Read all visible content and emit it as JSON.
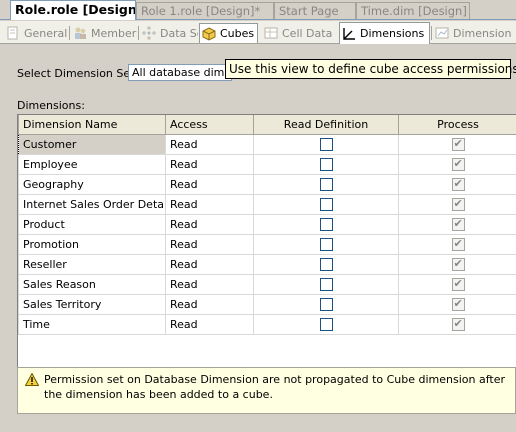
{
  "doc_tabs": [
    {
      "label": "Role.role [Design]",
      "active": true
    },
    {
      "label": "Role 1.role [Design]*",
      "active": false
    },
    {
      "label": "Start Page",
      "active": false
    },
    {
      "label": "Time.dim [Design]",
      "active": false
    }
  ],
  "view_tabs": [
    {
      "label": "General",
      "icon": "general-icon"
    },
    {
      "label": "Members",
      "icon": "members-icon"
    },
    {
      "label": "Data Sources",
      "icon": "data-sources-icon"
    },
    {
      "label": "Cubes",
      "icon": "cube-icon"
    },
    {
      "label": "Cell Data",
      "icon": "cell-data-icon"
    },
    {
      "label": "Dimensions",
      "icon": "dimensions-icon"
    },
    {
      "label": "Dimension Data",
      "icon": "dimension-data-icon"
    }
  ],
  "select_dimension_set": {
    "label": "Select Dimension Set:",
    "value": "All database dimensions"
  },
  "tooltip": "Use this view to define cube access permissions.",
  "dimensions_label": "Dimensions:",
  "grid": {
    "columns": [
      "Dimension Name",
      "Access",
      "Read Definition",
      "Process"
    ],
    "rows": [
      {
        "name": "Customer",
        "access": "Read",
        "read_definition": false,
        "process": true
      },
      {
        "name": "Employee",
        "access": "Read",
        "read_definition": false,
        "process": true
      },
      {
        "name": "Geography",
        "access": "Read",
        "read_definition": false,
        "process": true
      },
      {
        "name": "Internet Sales Order Details",
        "access": "Read",
        "read_definition": false,
        "process": true
      },
      {
        "name": "Product",
        "access": "Read",
        "read_definition": false,
        "process": true
      },
      {
        "name": "Promotion",
        "access": "Read",
        "read_definition": false,
        "process": true
      },
      {
        "name": "Reseller",
        "access": "Read",
        "read_definition": false,
        "process": true
      },
      {
        "name": "Sales Reason",
        "access": "Read",
        "read_definition": false,
        "process": true
      },
      {
        "name": "Sales Territory",
        "access": "Read",
        "read_definition": false,
        "process": true
      },
      {
        "name": "Time",
        "access": "Read",
        "read_definition": false,
        "process": true
      }
    ]
  },
  "message": "Permission set on Database Dimension are not propagated to Cube dimension after the dimension has been added to a cube.",
  "colors": {
    "tooltip_bg": "#ffffe1",
    "panel_bg": "#d4d0c8",
    "active_tab_border": "#7f9db9"
  }
}
